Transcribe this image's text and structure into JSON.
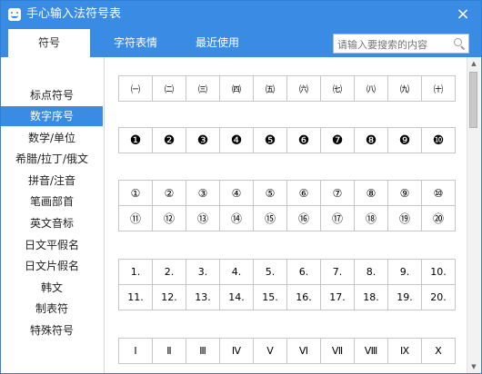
{
  "window": {
    "title": "手心输入法符号表",
    "close_glyph": "×"
  },
  "tabs": [
    {
      "label": "符号",
      "active": true
    },
    {
      "label": "字符表情",
      "active": false
    },
    {
      "label": "最近使用",
      "active": false
    }
  ],
  "search": {
    "placeholder": "请输入要搜索的内容"
  },
  "sidebar": {
    "items": [
      {
        "label": "标点符号",
        "active": false
      },
      {
        "label": "数字序号",
        "active": true
      },
      {
        "label": "数学/单位",
        "active": false
      },
      {
        "label": "希腊/拉丁/俄文",
        "active": false
      },
      {
        "label": "拼音/注音",
        "active": false
      },
      {
        "label": "笔画部首",
        "active": false
      },
      {
        "label": "英文音标",
        "active": false
      },
      {
        "label": "日文平假名",
        "active": false
      },
      {
        "label": "日文片假名",
        "active": false
      },
      {
        "label": "韩文",
        "active": false
      },
      {
        "label": "制表符",
        "active": false
      },
      {
        "label": "特殊符号",
        "active": false
      }
    ]
  },
  "symbol_groups": [
    {
      "rows": [
        [
          "㈠",
          "㈡",
          "㈢",
          "㈣",
          "㈤",
          "㈥",
          "㈦",
          "㈧",
          "㈨",
          "㈩"
        ]
      ]
    },
    {
      "rows": [
        [
          "❶",
          "❷",
          "❸",
          "❹",
          "❺",
          "❻",
          "❼",
          "❽",
          "❾",
          "❿"
        ]
      ]
    },
    {
      "rows": [
        [
          "①",
          "②",
          "③",
          "④",
          "⑤",
          "⑥",
          "⑦",
          "⑧",
          "⑨",
          "⑩"
        ],
        [
          "⑪",
          "⑫",
          "⑬",
          "⑭",
          "⑮",
          "⑯",
          "⑰",
          "⑱",
          "⑲",
          "⑳"
        ]
      ]
    },
    {
      "rows": [
        [
          "1.",
          "2.",
          "3.",
          "4.",
          "5.",
          "6.",
          "7.",
          "8.",
          "9.",
          "10."
        ],
        [
          "11.",
          "12.",
          "13.",
          "14.",
          "15.",
          "16.",
          "17.",
          "18.",
          "19.",
          "20."
        ]
      ]
    },
    {
      "rows": [
        [
          "Ⅰ",
          "Ⅱ",
          "Ⅲ",
          "Ⅳ",
          "Ⅴ",
          "Ⅵ",
          "Ⅶ",
          "Ⅷ",
          "Ⅸ",
          "Ⅹ"
        ]
      ]
    }
  ],
  "scrollbar": {
    "up_glyph": "▲",
    "down_glyph": "▼"
  }
}
